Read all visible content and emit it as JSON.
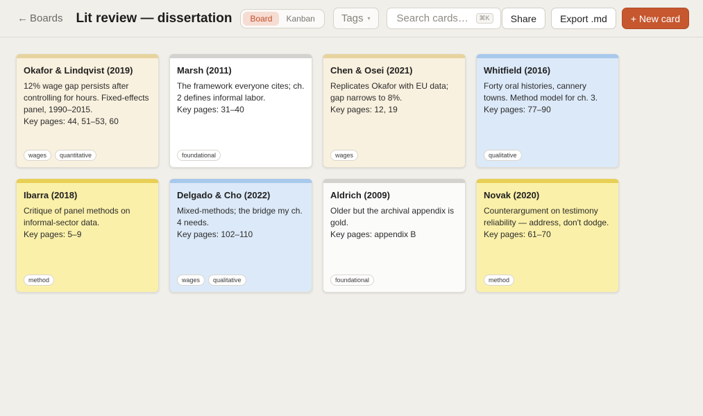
{
  "header": {
    "back_label": "Boards",
    "back_arrow": "←",
    "title": "Lit review — dissertation",
    "views": [
      "Board",
      "Kanban"
    ],
    "active_view": "Board",
    "tags_label": "Tags",
    "tags_caret": "▾",
    "search_placeholder": "Search cards…",
    "search_shortcut": "⌘K",
    "share_label": "Share",
    "export_label": "Export .md",
    "new_card_label": "+ New card"
  },
  "colors": {
    "accent": "#c6572f",
    "beige": "#f9f1df",
    "beige_top": "#e6d39e",
    "white": "#ffffff",
    "white_top": "#d4d2cf",
    "blue": "#dce9f8",
    "blue_top": "#a8c8ec",
    "yellow": "#fbf0a9",
    "yellow_top": "#e8cf55",
    "offwhite": "#fbfbfa",
    "offwhite_top": "#d4d2cf"
  },
  "cards": [
    {
      "title": "Okafor & Lindqvist (2019)",
      "body": "12% wage gap persists after controlling for hours. Fixed-effects panel, 1990–2015.",
      "key_pages": "Key pages: 44, 51–53, 60",
      "tags": [
        "wages",
        "quantitative"
      ],
      "color": "beige"
    },
    {
      "title": "Marsh (2011)",
      "body": "The framework everyone cites; ch. 2 defines informal labor.",
      "key_pages": "Key pages: 31–40",
      "tags": [
        "foundational"
      ],
      "color": "white"
    },
    {
      "title": "Chen & Osei (2021)",
      "body": "Replicates Okafor with EU data; gap narrows to 8%.",
      "key_pages": "Key pages: 12, 19",
      "tags": [
        "wages"
      ],
      "color": "beige"
    },
    {
      "title": "Whitfield (2016)",
      "body": "Forty oral histories, cannery towns. Method model for ch. 3.",
      "key_pages": "Key pages: 77–90",
      "tags": [
        "qualitative"
      ],
      "color": "blue"
    },
    {
      "title": "Ibarra (2018)",
      "body": "Critique of panel methods on informal-sector data.",
      "key_pages": "Key pages: 5–9",
      "tags": [
        "method"
      ],
      "color": "yellow"
    },
    {
      "title": "Delgado & Cho (2022)",
      "body": "Mixed-methods; the bridge my ch. 4 needs.",
      "key_pages": "Key pages: 102–110",
      "tags": [
        "wages",
        "qualitative"
      ],
      "color": "blue"
    },
    {
      "title": "Aldrich (2009)",
      "body": "Older but the archival appendix is gold.",
      "key_pages": "Key pages: appendix B",
      "tags": [
        "foundational"
      ],
      "color": "offwhite"
    },
    {
      "title": "Novak (2020)",
      "body": "Counterargument on testimony reliability — address, don't dodge.",
      "key_pages": "Key pages: 61–70",
      "tags": [
        "method"
      ],
      "color": "yellow"
    }
  ]
}
